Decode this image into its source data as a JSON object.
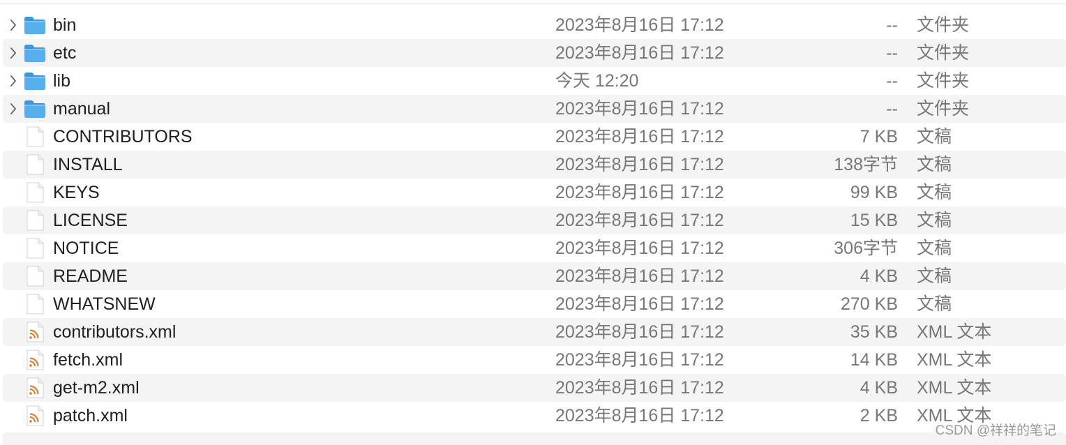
{
  "colors": {
    "alt_row": "#f4f4f5",
    "folder_blue": "#57aeec",
    "xml_orange": "#d5782c",
    "name_text": "#1f1f1f",
    "meta_text": "#777777"
  },
  "files": [
    {
      "name": "bin",
      "date": "2023年8月16日 17:12",
      "size": "--",
      "kind": "文件夹",
      "icon": "folder-icon",
      "expandable": true
    },
    {
      "name": "etc",
      "date": "2023年8月16日 17:12",
      "size": "--",
      "kind": "文件夹",
      "icon": "folder-icon",
      "expandable": true
    },
    {
      "name": "lib",
      "date": "今天 12:20",
      "size": "--",
      "kind": "文件夹",
      "icon": "folder-icon",
      "expandable": true
    },
    {
      "name": "manual",
      "date": "2023年8月16日 17:12",
      "size": "--",
      "kind": "文件夹",
      "icon": "folder-icon",
      "expandable": true
    },
    {
      "name": "CONTRIBUTORS",
      "date": "2023年8月16日 17:12",
      "size": "7 KB",
      "kind": "文稿",
      "icon": "document-icon",
      "expandable": false
    },
    {
      "name": "INSTALL",
      "date": "2023年8月16日 17:12",
      "size": "138字节",
      "kind": "文稿",
      "icon": "document-icon",
      "expandable": false
    },
    {
      "name": "KEYS",
      "date": "2023年8月16日 17:12",
      "size": "99 KB",
      "kind": "文稿",
      "icon": "document-icon",
      "expandable": false
    },
    {
      "name": "LICENSE",
      "date": "2023年8月16日 17:12",
      "size": "15 KB",
      "kind": "文稿",
      "icon": "document-icon",
      "expandable": false
    },
    {
      "name": "NOTICE",
      "date": "2023年8月16日 17:12",
      "size": "306字节",
      "kind": "文稿",
      "icon": "document-icon",
      "expandable": false
    },
    {
      "name": "README",
      "date": "2023年8月16日 17:12",
      "size": "4 KB",
      "kind": "文稿",
      "icon": "document-icon",
      "expandable": false
    },
    {
      "name": "WHATSNEW",
      "date": "2023年8月16日 17:12",
      "size": "270 KB",
      "kind": "文稿",
      "icon": "document-icon",
      "expandable": false
    },
    {
      "name": "contributors.xml",
      "date": "2023年8月16日 17:12",
      "size": "35 KB",
      "kind": "XML 文本",
      "icon": "xml-file-icon",
      "expandable": false
    },
    {
      "name": "fetch.xml",
      "date": "2023年8月16日 17:12",
      "size": "14 KB",
      "kind": "XML 文本",
      "icon": "xml-file-icon",
      "expandable": false
    },
    {
      "name": "get-m2.xml",
      "date": "2023年8月16日 17:12",
      "size": "4 KB",
      "kind": "XML 文本",
      "icon": "xml-file-icon",
      "expandable": false
    },
    {
      "name": "patch.xml",
      "date": "2023年8月16日 17:12",
      "size": "2 KB",
      "kind": "XML 文本",
      "icon": "xml-file-icon",
      "expandable": false
    }
  ],
  "watermark": "CSDN @祥祥的笔记"
}
